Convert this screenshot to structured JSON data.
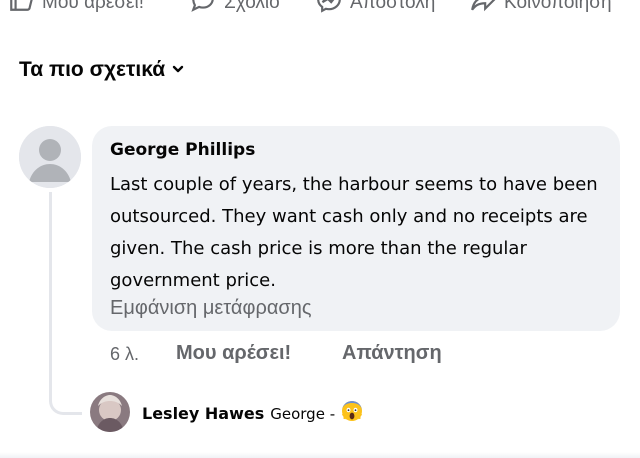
{
  "actions": {
    "like_label": "Μου αρέσει!",
    "comment_label": "Σχόλιο",
    "send_label": "Αποστολή",
    "share_label": "Κοινοποίηση"
  },
  "sort": {
    "label": "Τα πιο σχετικά"
  },
  "comment": {
    "author": "George Phillips",
    "text": "Last couple of years, the harbour seems to have been outsourced.  They want cash only and no receipts are given.  The cash price is more than the regular government price.",
    "translate_link": "Εμφάνιση μετάφρασης",
    "time": "6 λ.",
    "like_label": "Μου αρέσει!",
    "reply_label": "Απάντηση"
  },
  "reply": {
    "author": "Lesley Hawes",
    "text": "George -",
    "emoji": "screaming-face-emoji"
  },
  "colors": {
    "bubble": "#f0f2f5",
    "secondary_text": "#65676b",
    "primary_text": "#050505"
  }
}
